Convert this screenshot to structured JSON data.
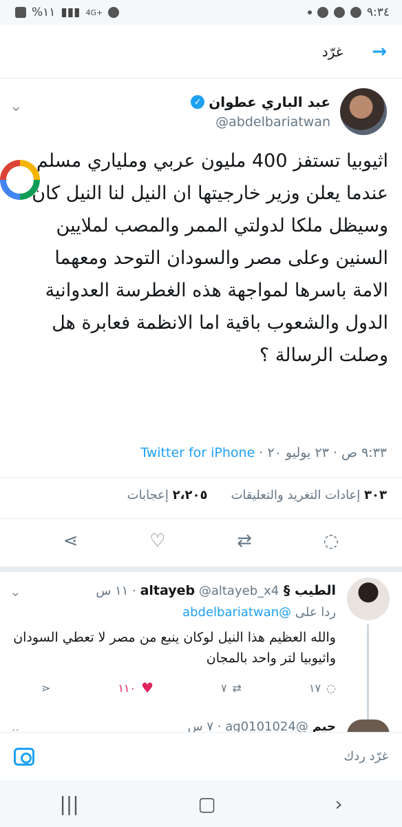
{
  "status_bar": {
    "battery": "%١١",
    "network": "4G+",
    "time": "٩:٣٤"
  },
  "header": {
    "title": "غرّد"
  },
  "tweet": {
    "author_name": "عبد الباري عطوان",
    "handle": "@abdelbariatwan",
    "text": "اثيوبيا تستفز 400 مليون عربي وملياري مسلم عندما يعلن وزير خارجيتها ان النيل لنا النيل كان وسيظل ملكا لدولتي الممر والمصب لملايين السنين وعلى مصر والسودان التوحد ومعهما الامة باسرها لمواجهة هذه الغطرسة العدوانية الدول والشعوب باقية اما الانظمة فعابرة هل وصلت الرسالة ؟",
    "time": "٩:٣٣ ص",
    "date": "٢٣ يوليو ٢٠",
    "separator": "·",
    "client": "Twitter for iPhone",
    "retweets_count": "٣٠٣",
    "retweets_label": "إعادات التغريد والتعليقات",
    "likes_count": "٢،٢٠٥",
    "likes_label": "إعجابات"
  },
  "reply": {
    "name": "الطيب § altayeb",
    "handle": "@altayeb_x4",
    "time": "١١ س",
    "replying_to_label": "ردا على",
    "replying_to": "@abdelbariatwan",
    "text": "والله العظيم هذا النيل لوكان ينبع من مصر لا تعطي السودان واثيوبيا لتر واحد بالمجان",
    "comments": "١٧",
    "retweets": "٧",
    "likes": "١١٠"
  },
  "next_reply": {
    "name": "حيم",
    "handle": "@ag0101024",
    "time": "٧ س"
  },
  "compose": {
    "placeholder": "غرّد ردك"
  },
  "icons": {
    "back": "arrow-right-icon",
    "verified": "verified-badge-icon",
    "share": "share-icon",
    "like": "heart-icon",
    "retweet": "retweet-icon",
    "reply": "comment-icon",
    "camera": "camera-icon"
  },
  "colors": {
    "accent": "#1da1f2",
    "like_active": "#e0245e",
    "muted_text": "#657786"
  }
}
